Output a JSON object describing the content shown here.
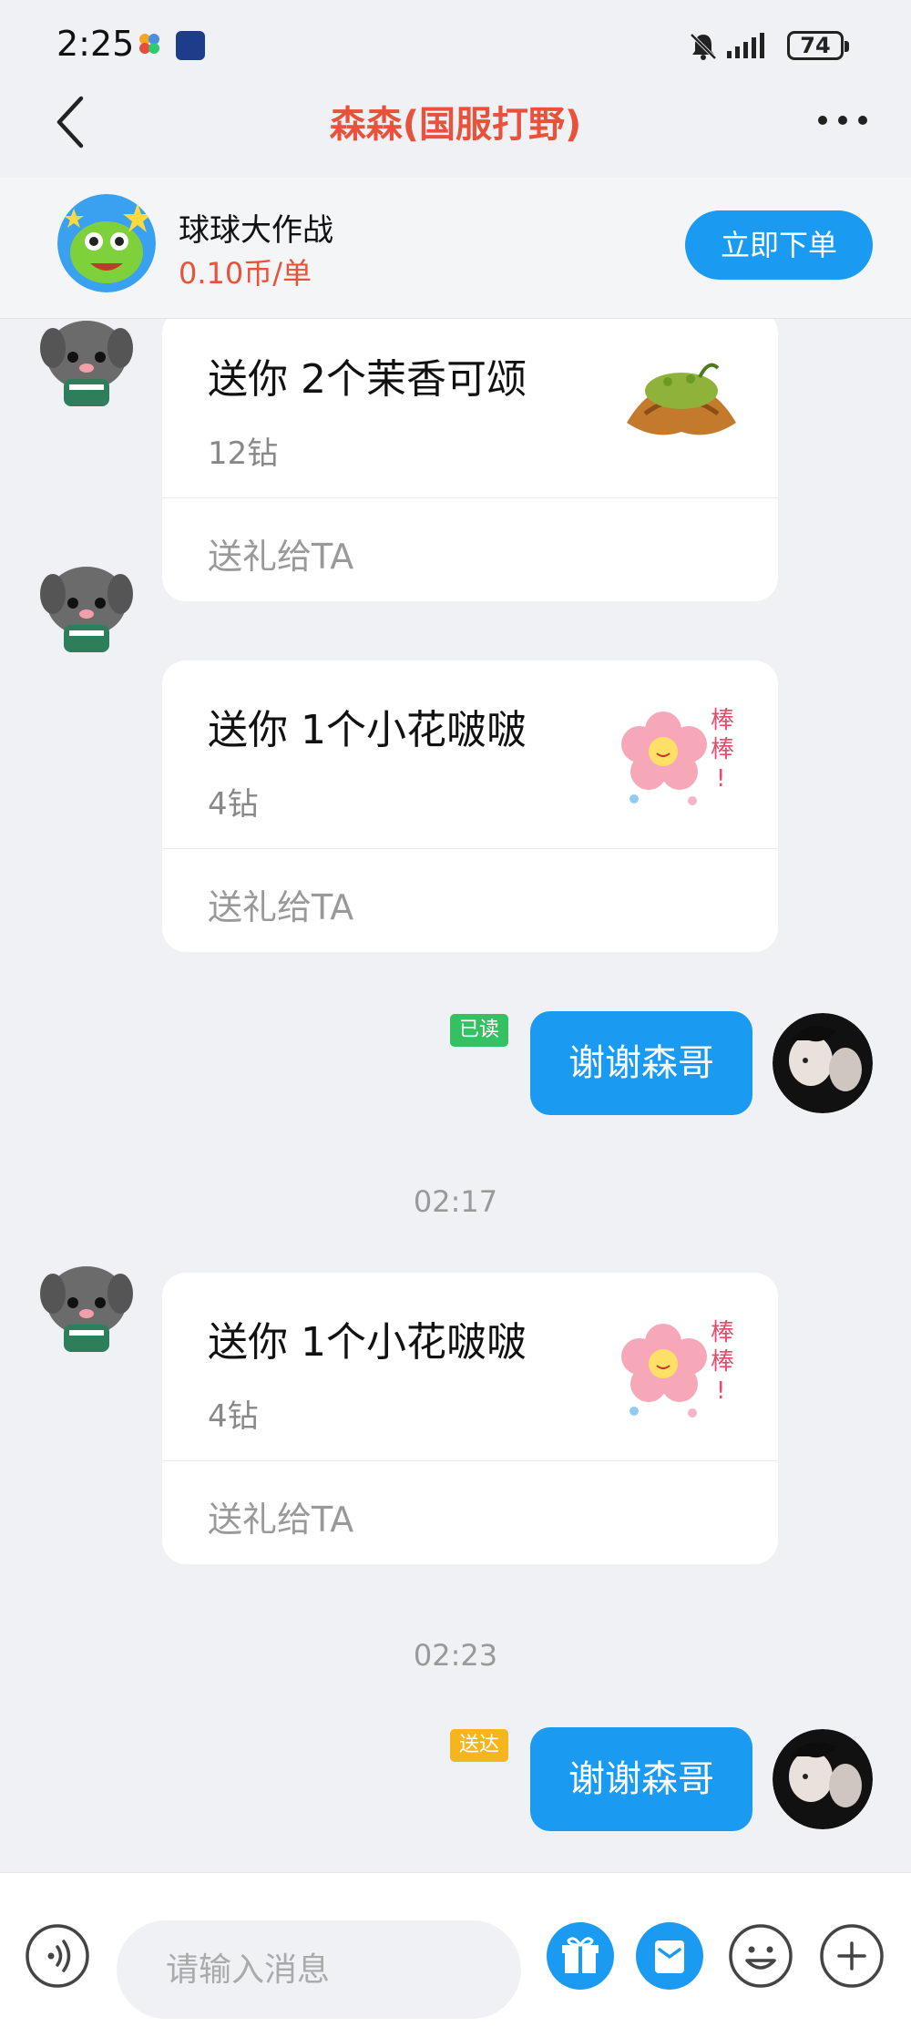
{
  "status_bar": {
    "time": "2:25",
    "battery": "74",
    "icons": [
      "app-icon",
      "app-icon",
      "bell-muted-icon",
      "signal-icon",
      "battery-icon"
    ]
  },
  "nav": {
    "title": "森森(国服打野)",
    "back_icon": "chevron-left-icon",
    "more_icon": "more-dots-icon"
  },
  "order": {
    "game_name": "球球大作战",
    "price": "0.10币/单",
    "button": "立即下单"
  },
  "messages": {
    "gift1": {
      "title": "送你 2个茉香可颂",
      "price": "12钻",
      "action": "送礼给TA"
    },
    "gift2": {
      "title": "送你 1个小花啵啵",
      "price": "4钻",
      "action": "送礼给TA"
    },
    "reply1": {
      "text": "谢谢森哥",
      "status": "已读"
    },
    "time1": "02:17",
    "gift3": {
      "title": "送你 1个小花啵啵",
      "price": "4钻",
      "action": "送礼给TA"
    },
    "time2": "02:23",
    "reply2": {
      "text": "谢谢森哥",
      "status": "送达"
    }
  },
  "input": {
    "placeholder": "请输入消息",
    "icons": [
      "voice-icon",
      "gift-icon",
      "order-icon",
      "emoji-icon",
      "plus-icon"
    ]
  },
  "colors": {
    "accent": "#1a9af0",
    "title_red": "#e8523a",
    "read_green": "#36c064",
    "sent_orange": "#f5b51c",
    "background": "#eff1f5"
  }
}
